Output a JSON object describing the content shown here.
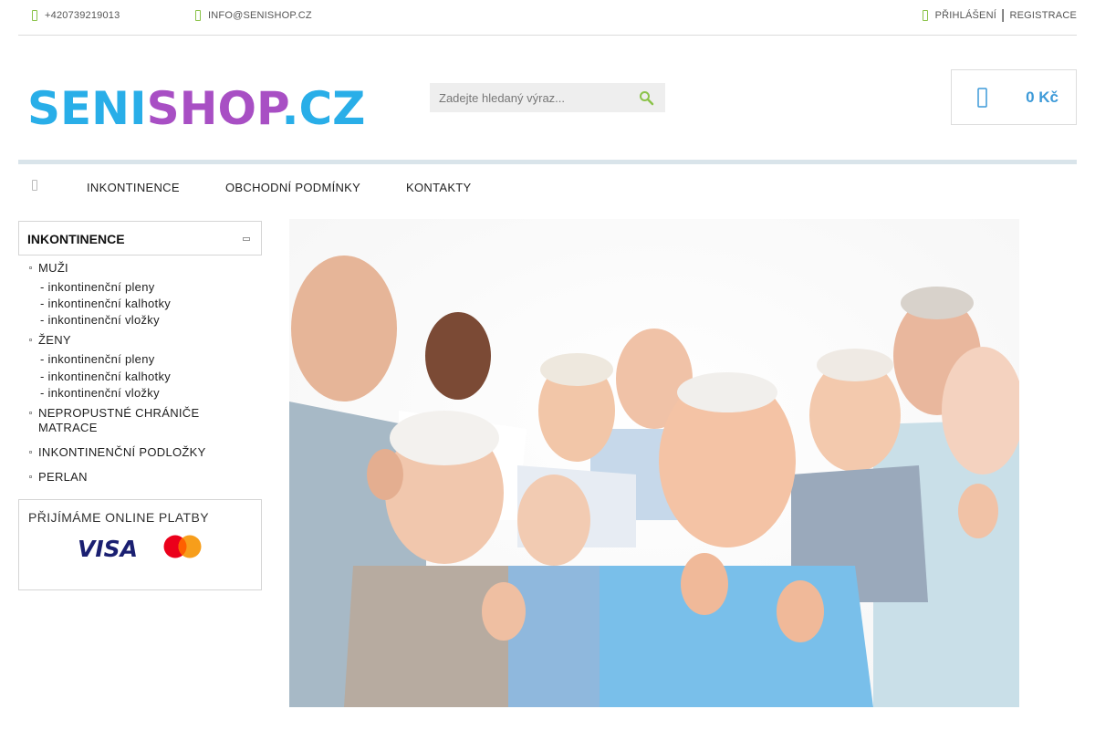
{
  "topbar": {
    "phone": "+420739219013",
    "email": "INFO@SENISHOP.CZ",
    "login": "PŘIHLÁŠENÍ",
    "separator": "|",
    "register": "REGISTRACE"
  },
  "header": {
    "logo_text": "SENISHOP.CZ",
    "search_placeholder": "Zadejte hledaný výraz...",
    "cart_total": "0 Kč"
  },
  "nav": {
    "items": [
      {
        "label": "INKONTINENCE"
      },
      {
        "label": "OBCHODNÍ PODMÍNKY"
      },
      {
        "label": "KONTAKTY"
      }
    ]
  },
  "sidebar": {
    "category_title": "INKONTINENCE",
    "categories": [
      {
        "label": "MUŽI",
        "sub": [
          "- inkontinenční pleny",
          "- inkontinenční kalhotky",
          "- inkontinenční vložky"
        ]
      },
      {
        "label": "ŽENY",
        "sub": [
          "- inkontinenční pleny",
          "- inkontinenční kalhotky",
          "- inkontinenční vložky"
        ]
      },
      {
        "label_line1": "NEPROPUSTNÉ CHRÁNIČE",
        "label_line2": "MATRACE"
      },
      {
        "label": "INKONTINENČNÍ PODLOŽKY"
      },
      {
        "label": "PERLAN"
      }
    ],
    "payments_title": "PŘIJÍMÁME ONLINE PLATBY",
    "visa_text": "VISA"
  },
  "colors": {
    "accent": "#3d9ad8",
    "icon_green": "#8bc34a",
    "logo_blue": "#29aee8",
    "logo_purple": "#a84fc4"
  }
}
